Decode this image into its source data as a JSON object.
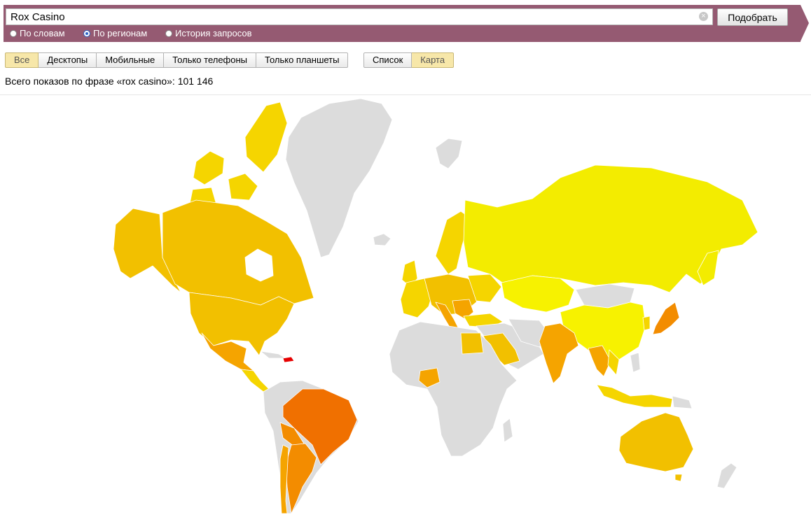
{
  "search": {
    "value": "Rox Casino",
    "submit_label": "Подобрать",
    "clear_glyph": "×"
  },
  "modes": [
    {
      "label": "По словам",
      "selected": false
    },
    {
      "label": "По регионам",
      "selected": true
    },
    {
      "label": "История запросов",
      "selected": false
    }
  ],
  "devices": [
    "Все",
    "Десктопы",
    "Мобильные",
    "Только телефоны",
    "Только планшеты"
  ],
  "device_selected": "Все",
  "views": [
    "Список",
    "Карта"
  ],
  "view_selected": "Карта",
  "summary": "Всего показов по фразе «rox casino»: 101 146",
  "colors": {
    "band": "#955a72",
    "no_data": "#dcdcdc",
    "low": "#f3ec00",
    "mid_low": "#f5d500",
    "mid": "#f2c000",
    "mid_high": "#f5a400",
    "high": "#f38c00",
    "very_high": "#f07000",
    "max": "#e60000"
  }
}
